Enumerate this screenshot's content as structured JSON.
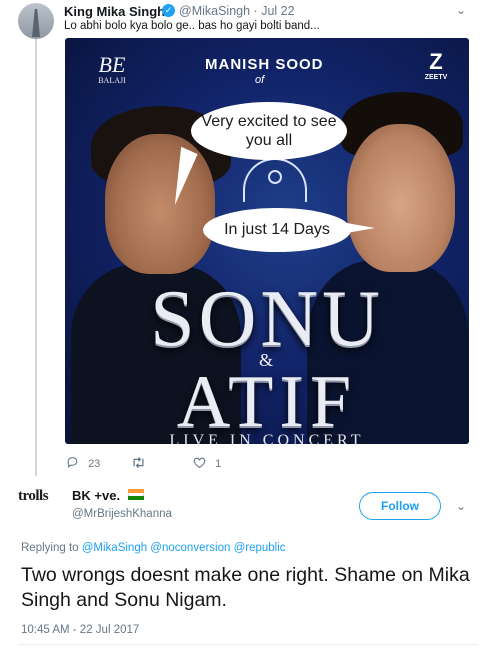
{
  "tweet1": {
    "name": "King Mika Singh",
    "handle": "@MikaSingh",
    "sep": "·",
    "date": "Jul 22",
    "text": "Lo abhi bolo kya bolo ge.. bas ho gayi bolti band...",
    "verified_icon": "verified-badge",
    "actions": {
      "replies": "23",
      "retweets": "",
      "likes": "1"
    },
    "poster": {
      "balaji_mark": "BE",
      "balaji_name": "BALAJI",
      "presenter": "MANISH SOOD",
      "of": "of",
      "zee_logo": "Z",
      "zee_tv": "ZEETV",
      "bubble1": "Very excited to see you all",
      "bubble2": "In just 14 Days",
      "title1": "SONU",
      "amp": "&",
      "title2": "ATIF",
      "subtitle": "LIVE IN CONCERT"
    }
  },
  "tweet2": {
    "avatar_text": "trolls",
    "name": "BK +ve.",
    "flag_colors": [
      "#ff9933",
      "#ffffff",
      "#138808"
    ],
    "handle": "@MrBrijeshKhanna",
    "follow_label": "Follow",
    "replying_prefix": "Replying to",
    "replying_to": "@MikaSingh @noconversion @republic",
    "text": "Two wrongs doesnt make one right. Shame on Mika Singh and Sonu Nigam.",
    "timestamp": "10:45 AM - 22 Jul 2017"
  },
  "colors": {
    "accent": "#1da1f2",
    "muted": "#657786",
    "text": "#14171a"
  }
}
